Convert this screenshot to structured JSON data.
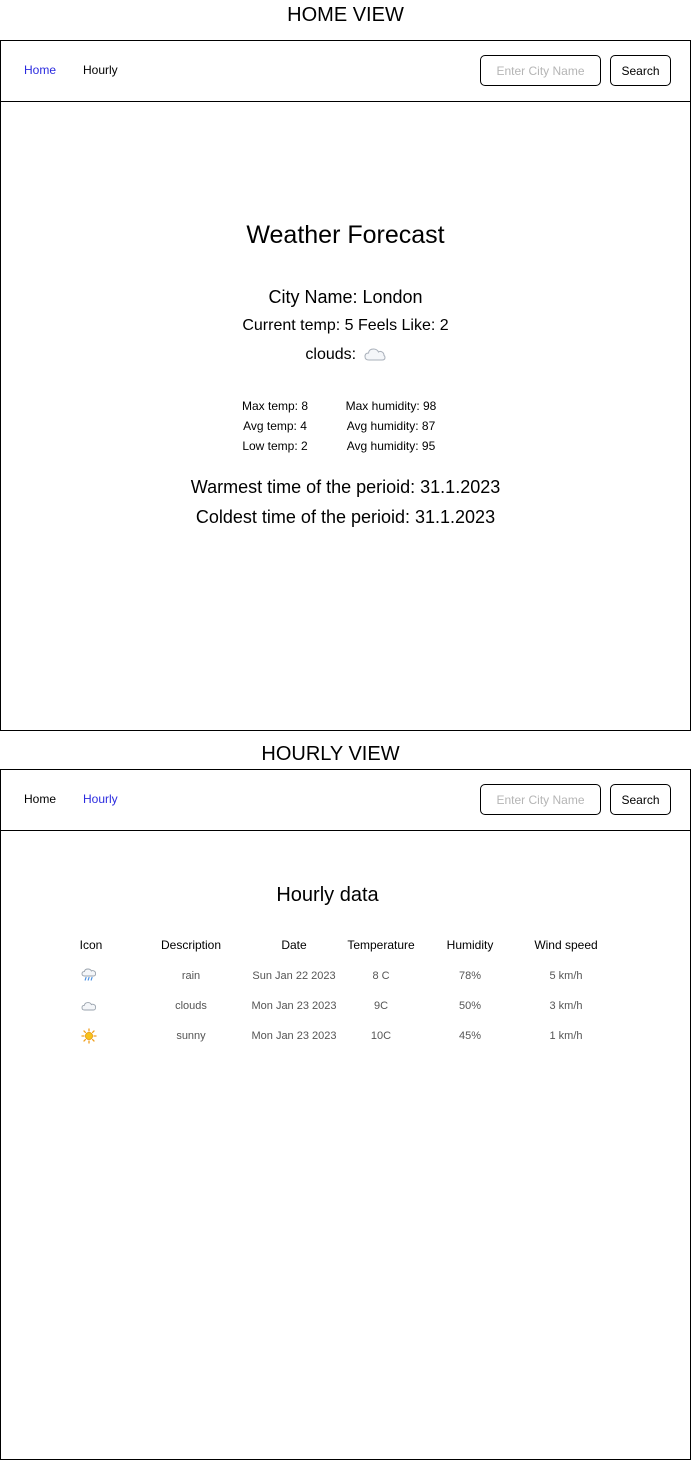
{
  "views": {
    "home_title": "HOME VIEW",
    "hourly_title": "HOURLY VIEW"
  },
  "nav": {
    "home_label": "Home",
    "hourly_label": "Hourly",
    "search_placeholder": "Enter City Name",
    "search_button": "Search",
    "active_color": "#2b2bdf"
  },
  "home": {
    "title": "Weather Forecast",
    "city_line": "City Name: London",
    "temp_line": "Current temp: 5 Feels Like: 2",
    "condition_label": "clouds:",
    "condition_icon": "cloud-icon",
    "stats_left": [
      "Max temp: 8",
      "Avg temp: 4",
      "Low temp: 2"
    ],
    "stats_right": [
      "Max humidity: 98",
      "Avg humidity: 87",
      "Avg humidity: 95"
    ],
    "warmest": "Warmest time of the perioid: 31.1.2023",
    "coldest": "Coldest time of the perioid: 31.1.2023"
  },
  "hourly": {
    "title": "Hourly data",
    "columns": [
      "Icon",
      "Description",
      "Date",
      "Temperature",
      "Humidity",
      "Wind speed"
    ],
    "rows": [
      {
        "icon": "rain-cloud-icon",
        "description": "rain",
        "date": "Sun Jan 22 2023",
        "temperature": "8 C",
        "humidity": "78%",
        "wind": "5 km/h"
      },
      {
        "icon": "cloud-icon",
        "description": "clouds",
        "date": "Mon Jan 23 2023",
        "temperature": "9C",
        "humidity": "50%",
        "wind": "3 km/h"
      },
      {
        "icon": "sun-icon",
        "description": "sunny",
        "date": "Mon Jan 23 2023",
        "temperature": "10C",
        "humidity": "45%",
        "wind": "1 km/h"
      }
    ]
  }
}
